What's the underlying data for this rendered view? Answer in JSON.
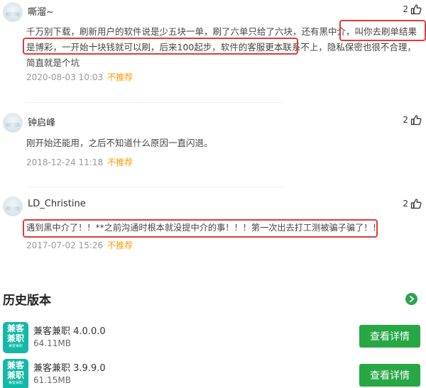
{
  "reviews": [
    {
      "username": "嘶溜~",
      "likes": "2",
      "content_before": "千万别下载，刷新用户的软件说是少五块一单，刷了六单只给了六块，还有黑中介，",
      "content_highlight_a": "叫你去刷单结果是博",
      "content_highlight_b": "彩，一开始十块钱就可以刷，后来100起步，软件的客服更本联系不上，",
      "content_after": "隐私保密也很不合理，简直就是个坑",
      "date": "2020-08-03 10:03",
      "recommend": "不推荐"
    },
    {
      "username": "钟启峰",
      "likes": "2",
      "content": "刚开始还能用，之后不知道什么原因一直闪退。",
      "date": "2018-12-24 11:18",
      "recommend": "不推荐"
    },
    {
      "username": "LD_Christine",
      "likes": "2",
      "content": "遇到黑中介了！！**之前沟通时根本就没提中介的事！！！第一次出去打工测被骗子骗了！！",
      "date": "2017-07-02 15:26",
      "recommend": "不推荐"
    }
  ],
  "history": {
    "title": "历史版本",
    "more_icon": "arrow-right-circle-icon",
    "versions": [
      {
        "icon_line1": "兼客",
        "icon_line2": "兼职",
        "icon_sub": "兼客兼职",
        "name": "兼客兼职 4.0.0.0",
        "size": "64.11MB",
        "button": "查看详情"
      },
      {
        "icon_line1": "兼客",
        "icon_line2": "兼职",
        "icon_sub": "兼客兼职",
        "name": "兼客兼职 3.9.9.0",
        "size": "61.15MB",
        "button": "查看详情"
      }
    ]
  },
  "colors": {
    "highlight": "#e53935",
    "accent_green": "#28a745",
    "not_recommend": "#ff9800"
  }
}
